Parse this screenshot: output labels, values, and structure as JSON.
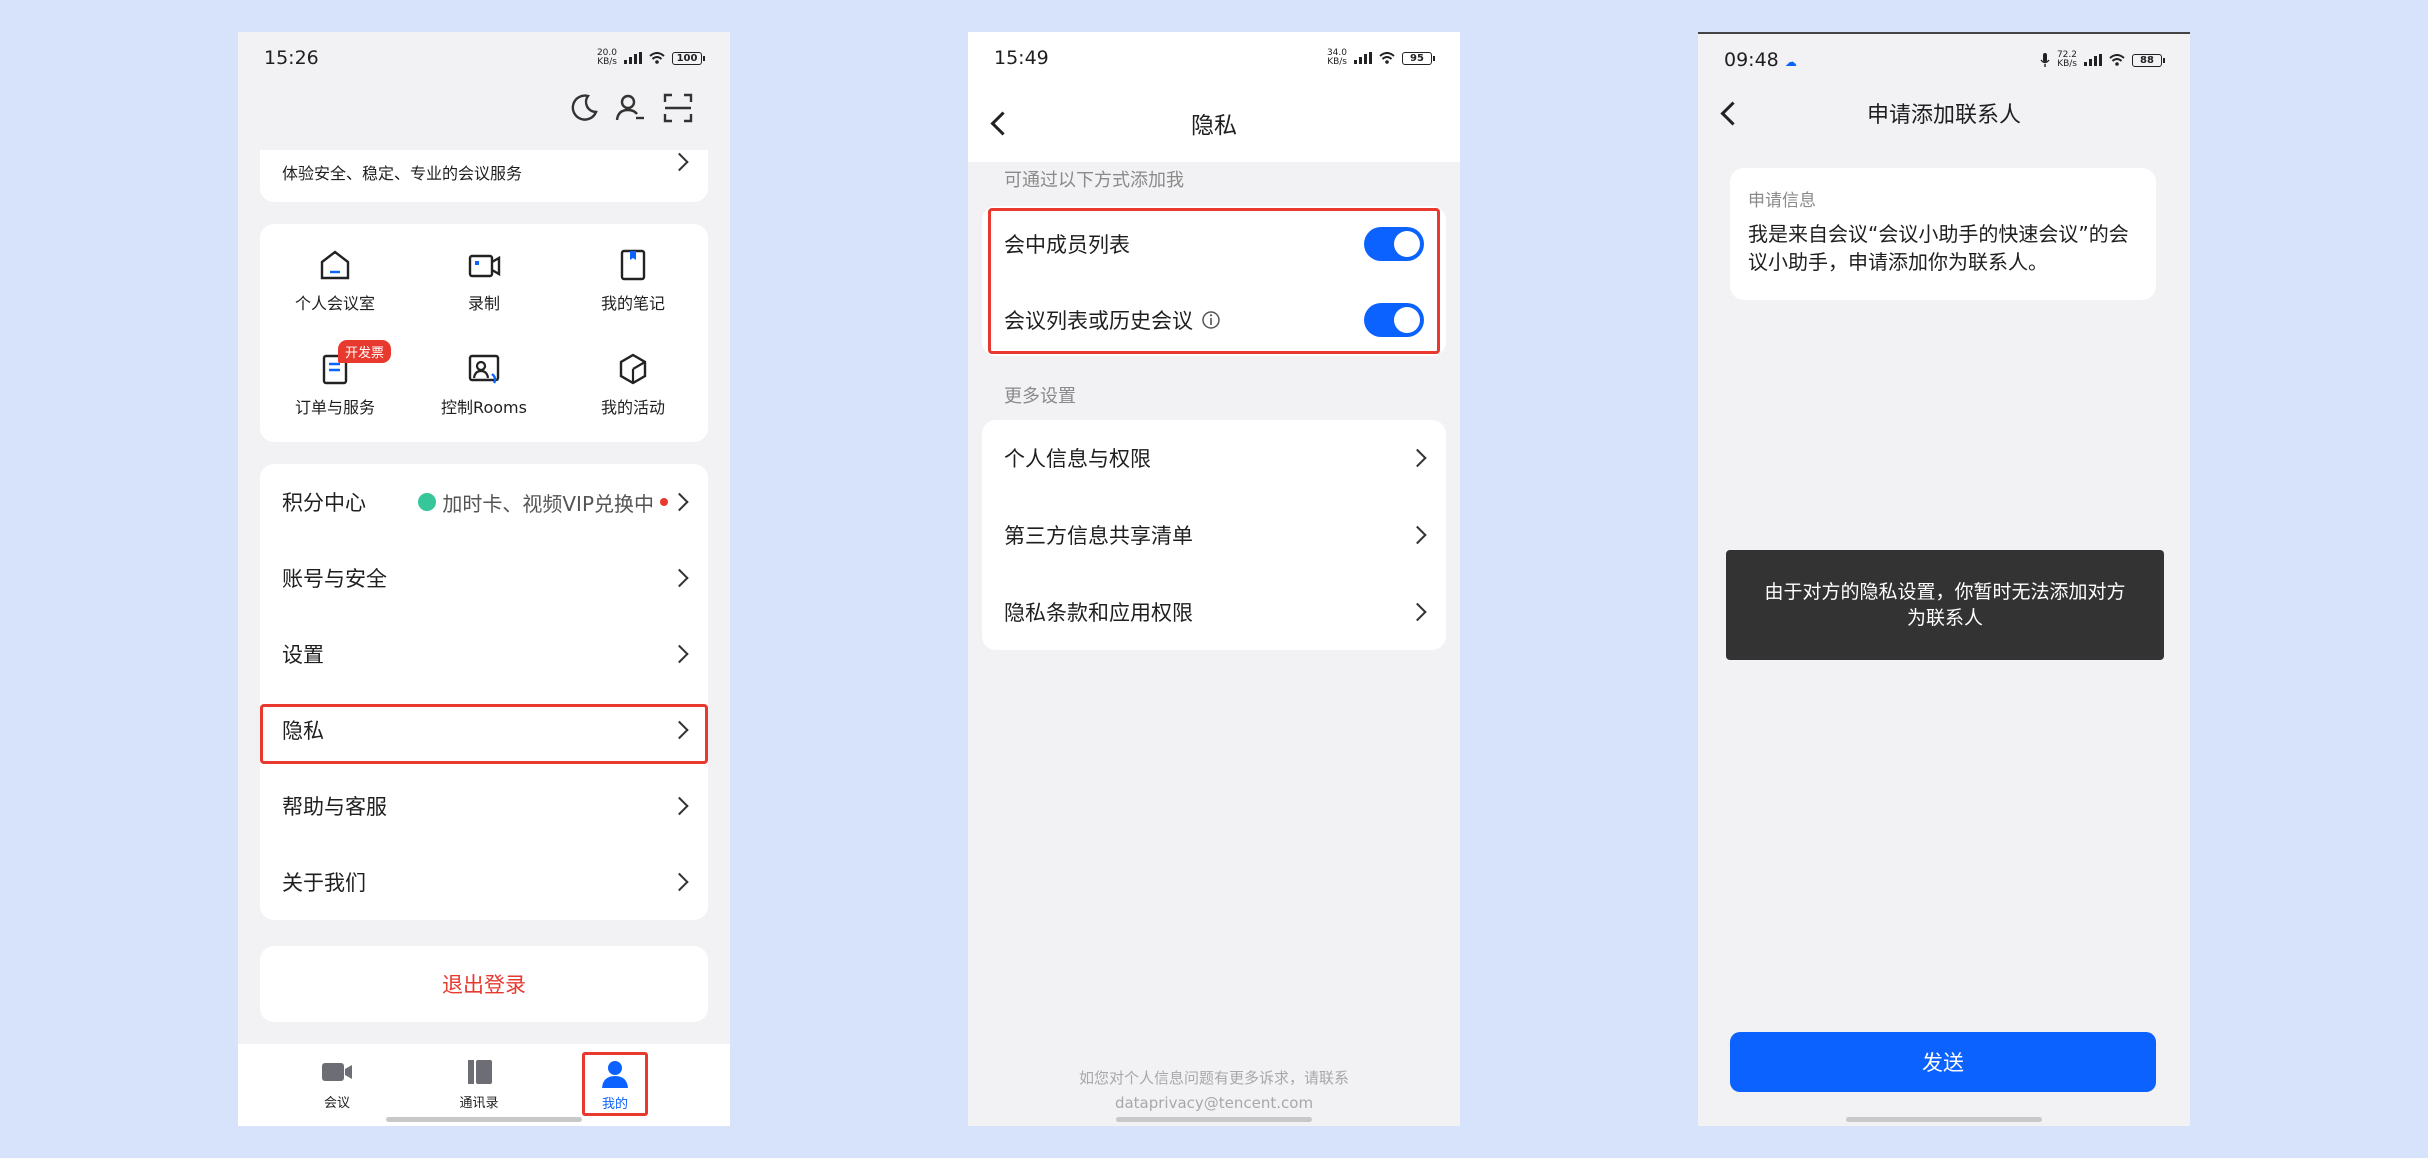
{
  "phone1": {
    "status_time": "15:26",
    "net_speed": "20.0",
    "net_unit": "KB/s",
    "battery": "100",
    "banner_text": "体验安全、稳定、专业的会议服务",
    "grid": [
      {
        "label": "个人会议室",
        "icon": "house-icon"
      },
      {
        "label": "录制",
        "icon": "video-record-icon"
      },
      {
        "label": "我的笔记",
        "icon": "note-icon"
      },
      {
        "label": "订单与服务",
        "icon": "order-icon",
        "badge": "开发票"
      },
      {
        "label": "控制Rooms",
        "icon": "rooms-icon"
      },
      {
        "label": "我的活动",
        "icon": "cube-icon"
      }
    ],
    "menu": [
      {
        "label": "积分中心",
        "extra": "加时卡、视频VIP兑换中"
      },
      {
        "label": "账号与安全"
      },
      {
        "label": "设置"
      },
      {
        "label": "隐私"
      },
      {
        "label": "帮助与客服"
      },
      {
        "label": "关于我们"
      }
    ],
    "logout": "退出登录",
    "tabs": [
      {
        "label": "会议"
      },
      {
        "label": "通讯录"
      },
      {
        "label": "我的"
      }
    ],
    "accent": "#0b62ff",
    "danger": "#e8392f"
  },
  "phone2": {
    "status_time": "15:49",
    "net_speed": "34.0",
    "net_unit": "KB/s",
    "battery": "95",
    "title": "隐私",
    "section1": "可通过以下方式添加我",
    "toggles": [
      {
        "label": "会中成员列表",
        "on": true
      },
      {
        "label": "会议列表或历史会议",
        "on": true
      }
    ],
    "section2": "更多设置",
    "more": [
      {
        "label": "个人信息与权限"
      },
      {
        "label": "第三方信息共享清单"
      },
      {
        "label": "隐私条款和应用权限"
      }
    ],
    "footer_line1": "如您对个人信息问题有更多诉求，请联系",
    "footer_line2": "dataprivacy@tencent.com"
  },
  "phone3": {
    "status_time": "09:48",
    "net_speed": "72.2",
    "net_unit": "KB/s",
    "battery": "88",
    "title": "申请添加联系人",
    "info_label": "申请信息",
    "info_text": "我是来自会议“会议小助手的快速会议”的会议小助手，申请添加你为联系人。",
    "toast": "由于对方的隐私设置，你暂时无法添加对方为联系人",
    "send": "发送"
  }
}
